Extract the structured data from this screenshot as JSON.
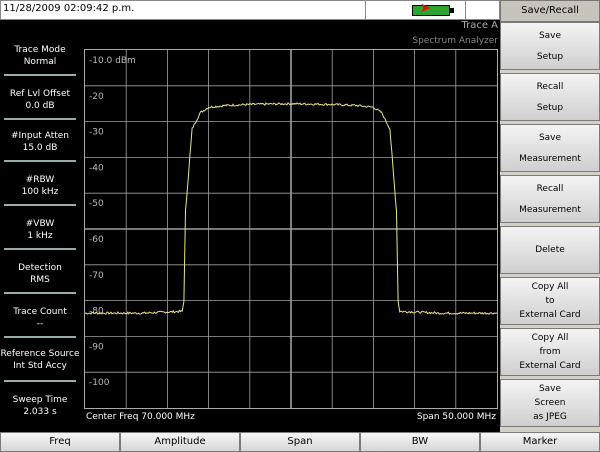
{
  "status": {
    "datetime": "11/28/2009 02:09:42 p.m.",
    "trace_label": "Trace A",
    "mode_label": "Spectrum Analyzer"
  },
  "params": [
    {
      "label": "Trace Mode",
      "value": "Normal"
    },
    {
      "label": "Ref Lvl Offset",
      "value": "0.0 dB"
    },
    {
      "label": "#Input Atten",
      "value": "15.0 dB"
    },
    {
      "label": "#RBW",
      "value": "100 kHz"
    },
    {
      "label": "#VBW",
      "value": "1 kHz"
    },
    {
      "label": "Detection",
      "value": "RMS"
    },
    {
      "label": "Trace Count",
      "value": "--"
    },
    {
      "label": "Reference Source",
      "value": "Int Std Accy"
    },
    {
      "label": "Sweep Time",
      "value": "2.033 s"
    }
  ],
  "plot": {
    "ref_level_label": "-10.0 dBm",
    "center_freq": "Center Freq 70.000 MHz",
    "span": "Span 50.000 MHz",
    "grid_color": "#a0a0a0",
    "trace_color": "#e6e68c"
  },
  "chart_data": {
    "type": "line",
    "x_unit": "MHz",
    "y_unit": "dBm",
    "xlim": [
      45,
      95
    ],
    "ylim": [
      -110,
      -10
    ],
    "yticks": [
      "-10.0 dBm",
      "-20",
      "-30",
      "-40",
      "-50",
      "-60",
      "-70",
      "-80",
      "-90",
      "-100"
    ],
    "grid": true,
    "series": [
      {
        "x": [
          45,
          52,
          56.8,
          57.0,
          57.2,
          58,
          59,
          60,
          62,
          65,
          70,
          75,
          78,
          80,
          81,
          82,
          82.8,
          83.0,
          83.2,
          88,
          95
        ],
        "y": [
          -83.5,
          -83.5,
          -83,
          -80,
          -55,
          -32,
          -27.5,
          -26,
          -25.5,
          -25.2,
          -25,
          -25.2,
          -25.5,
          -26,
          -27.5,
          -32,
          -55,
          -80,
          -83,
          -83.5,
          -83.5
        ]
      }
    ]
  },
  "softkeys": {
    "title": "Save/Recall",
    "keys": [
      {
        "line1": "Save",
        "line2": "Setup",
        "line3": ""
      },
      {
        "line1": "Recall",
        "line2": "Setup",
        "line3": ""
      },
      {
        "line1": "Save",
        "line2": "Measurement",
        "line3": ""
      },
      {
        "line1": "Recall",
        "line2": "Measurement",
        "line3": ""
      },
      {
        "line1": "Delete",
        "line2": "",
        "line3": ""
      },
      {
        "line1": "Copy All",
        "line2": "to",
        "line3": "External Card"
      },
      {
        "line1": "Copy All",
        "line2": "from",
        "line3": "External Card"
      },
      {
        "line1": "Save",
        "line2": "Screen",
        "line3": "as JPEG"
      }
    ]
  },
  "bottom_menu": [
    "Freq",
    "Amplitude",
    "Span",
    "BW",
    "Marker"
  ],
  "icons": {
    "battery": "battery-charging-icon",
    "plug": "power-plug-icon"
  }
}
